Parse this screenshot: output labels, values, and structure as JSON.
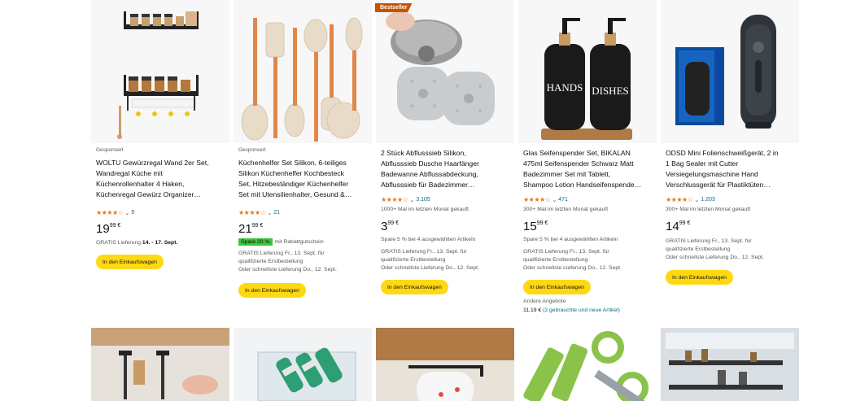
{
  "products": [
    {
      "sponsored": "Gesponsert",
      "title_lines": [
        "WOLTU Gewürzregal Wand 2er Set,",
        "Wandregal Küche mit",
        "Küchenrollenhalter 4 Haken,",
        "Küchenregal Gewürz Organizer…"
      ],
      "rating_count": "9",
      "price_main": "19",
      "price_cents": "99 €",
      "delivery_pre": "GRATIS Lieferung ",
      "delivery_date": "14. - 17. Sept.",
      "cart": "In den Einkaufswagen"
    },
    {
      "sponsored": "Gesponsert",
      "title_lines": [
        "Küchenhelfer Set Silikon, 6-teiliges",
        "Silikon Küchenhelfer Kochbesteck",
        "Set, Hitzebeständiger Küchenhelfer",
        "Set mit Utensilienhalter, Gesund &…"
      ],
      "rating_count": "21",
      "price_main": "21",
      "price_cents": "99 €",
      "deal_tag": "Spare 20 %",
      "deal_text": "mit Rabattgutschein",
      "delivery_lines": [
        "GRATIS Lieferung Fr., 13. Sept. für",
        "qualifizierte Erstbestellung",
        "Oder schnellste Lieferung Do., 12. Sept."
      ],
      "cart": "In den Einkaufswagen"
    },
    {
      "badge": "Bestseller",
      "title_lines": [
        "2 Stück Abflusssieb Silikon,",
        "Abflusssieb Dusche Haarfänger",
        "Badewanne Abflussabdeckung,",
        "Abflusssieb für Badezimmer…"
      ],
      "rating_count": "3.105",
      "bought": "1000+ Mal im letzten Monat gekauft",
      "price_main": "3",
      "price_cents": "99 €",
      "save_text": "Spare 5 % bei 4 ausgewählten Artikeln",
      "delivery_lines": [
        "GRATIS Lieferung Fr., 13. Sept. für",
        "qualifizierte Erstbestellung",
        "Oder schnellste Lieferung Do., 12. Sept."
      ],
      "cart": "In den Einkaufswagen"
    },
    {
      "title_lines": [
        "Glas Seifenspender Set, BIKALAN",
        "475ml Seifenspender Schwarz Matt",
        "Badezimmer Set mit Tablett,",
        "Shampoo Lotion Handseifenspende…"
      ],
      "rating_count": "471",
      "bought": "300+ Mal im letzten Monat gekauft",
      "price_main": "15",
      "price_cents": "99 €",
      "save_text": "Spare 5 % bei 4 ausgewählten Artikeln",
      "delivery_lines": [
        "GRATIS Lieferung Fr., 13. Sept. für",
        "qualifizierte Erstbestellung",
        "Oder schnellste Lieferung Do., 12. Sept."
      ],
      "cart": "In den Einkaufswagen",
      "other_offers": "Andere Angebote",
      "other_price": "11,19 €",
      "other_link": "(2 gebrauchte und neue Artikel)",
      "bottle_labels": [
        "HANDS",
        "DISHES"
      ]
    },
    {
      "title_lines": [
        "ODSD Mini Folienschweißgerät, 2 in",
        "1 Bag Sealer mit Cutter",
        "Versiegelungsmaschine Hand",
        "Verschlussgerät für Plastiktüten…"
      ],
      "rating_count": "1.203",
      "bought": "300+ Mal im letzten Monat gekauft",
      "price_main": "14",
      "price_cents": "99 €",
      "delivery_lines": [
        "GRATIS Lieferung Fr., 13. Sept. für",
        "qualifizierte Erstbestellung",
        "Oder schnellste Lieferung Do., 12. Sept."
      ],
      "cart": "In den Einkaufswagen"
    }
  ],
  "colors": {
    "star": "#de7921",
    "link": "#007185",
    "cart": "#ffd814",
    "badge": "#c45500",
    "deal": "#3ec43e"
  }
}
